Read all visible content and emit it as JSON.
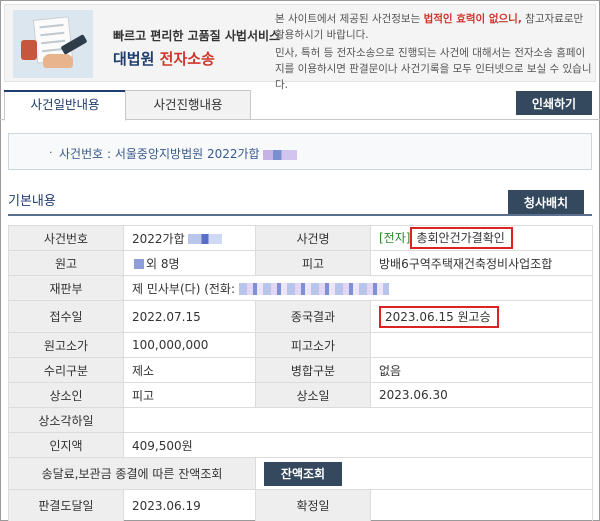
{
  "banner": {
    "tagline": "빠르고 편리한 고품질 사법서비스",
    "brand_main": "대법원",
    "brand_accent": "전자소송",
    "notice_pre": "본 사이트에서 제공된 사건정보는 ",
    "notice_emph": "법적인 효력이 없으니,",
    "notice_post": " 참고자료로만 활용하시기 바랍니다.",
    "notice_2": "민사, 특허 등 전자소송으로 진행되는 사건에 대해서는 전자소송 홈페이지를 이용하시면 판결문이나 사건기록을 모두 인터넷으로 보실 수 있습니다."
  },
  "tabs": [
    {
      "label": "사건일반내용"
    },
    {
      "label": "사건진행내용"
    }
  ],
  "print_label": "인쇄하기",
  "case_header": {
    "text": "사건번호 : 서울중앙지방법원 2022가합"
  },
  "section": {
    "title": "기본내용",
    "button_label": "청사배치"
  },
  "table": {
    "case_no_label": "사건번호",
    "case_no_value": "2022가합",
    "case_name_label": "사건명",
    "case_name_prefix": "[전자]",
    "case_name_value": "총회안건가결확인",
    "plaintiff_label": "원고",
    "plaintiff_value": "외 8명",
    "defendant_label": "피고",
    "defendant_value": "방배6구역주택재건축정비사업조합",
    "division_label": "재판부",
    "division_value": "제  민사부(다) (전화:",
    "filed_label": "접수일",
    "filed_value": "2022.07.15",
    "result_label": "종국결과",
    "result_value": "2023.06.15 원고승",
    "claim_p_label": "원고소가",
    "claim_p_value": "100,000,000",
    "claim_d_label": "피고소가",
    "claim_d_value": "",
    "accept_label": "수리구분",
    "accept_value": "제소",
    "merge_label": "병합구분",
    "merge_value": "없음",
    "appellant_label": "상소인",
    "appellant_value": "피고",
    "appeal_date_label": "상소일",
    "appeal_date_value": "2023.06.30",
    "appeal_reject_label": "상소각하일",
    "appeal_reject_value": "",
    "stamp_label": "인지액",
    "stamp_value": "409,500원",
    "balance_label": "송달료,보관금 종결에 따른 잔액조회",
    "balance_button": "잔액조회",
    "delivered_label": "판결도달일",
    "delivered_value": "2023.06.19",
    "final_label": "확정일",
    "final_value": ""
  },
  "colors": {
    "navy": "#1e3c6e",
    "button": "#34495e",
    "highlight_box": "#dd2222",
    "electronic_tag": "#2d8a2d"
  },
  "icons": [
    "court-banner-illustration"
  ]
}
